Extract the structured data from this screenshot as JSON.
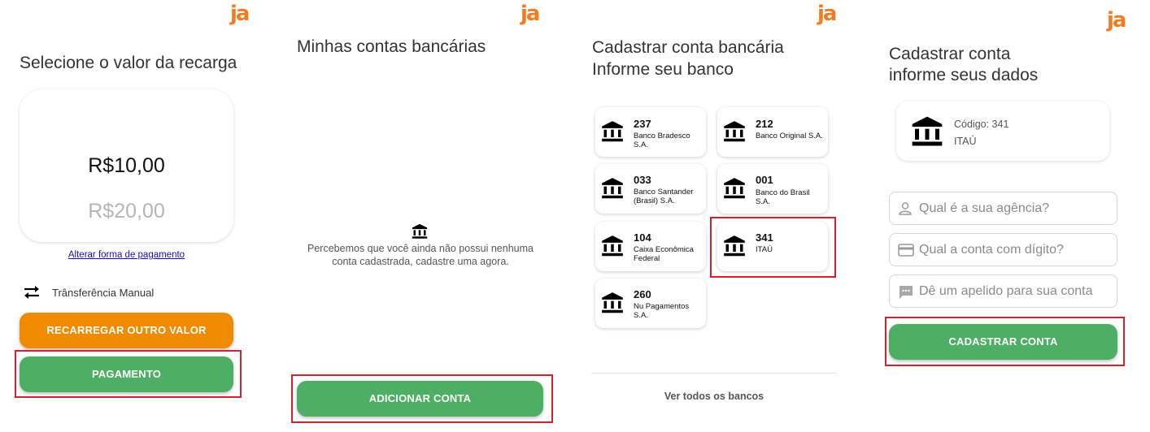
{
  "brand": {
    "logo_text": "ja",
    "accent": "#f07b21",
    "green": "#4caf63",
    "orange": "#f08a00",
    "highlight": "#d9202a"
  },
  "screen1": {
    "title": "Selecione o valor da recarga",
    "value_selected": "R$10,00",
    "value_next": "R$20,00",
    "change_payment_link": "Alterar forma de pagamento",
    "transfer_icon": "swap-arrows-icon",
    "transfer_label": "Trânsferência Manual",
    "recharge_other_button": "RECARREGAR OUTRO VALOR",
    "payment_button": "PAGAMENTO"
  },
  "screen2": {
    "title": "Minhas contas bancárias",
    "empty_icon": "bank-icon",
    "empty_message": "Percebemos que você ainda não possui nenhuma conta cadastrada, cadastre uma agora.",
    "add_account_button": "ADICIONAR CONTA"
  },
  "screen3": {
    "title_line1": "Cadastrar conta bancária",
    "title_line2": "Informe seu banco",
    "banks": [
      {
        "code": "237",
        "name": "Banco Bradesco S.A."
      },
      {
        "code": "212",
        "name": "Banco Original S.A."
      },
      {
        "code": "033",
        "name": "Banco Santander (Brasil) S.A."
      },
      {
        "code": "001",
        "name": "Banco do Brasil S.A."
      },
      {
        "code": "104",
        "name": "Caixa Econômica Federal"
      },
      {
        "code": "341",
        "name": "ITAÚ"
      },
      {
        "code": "260",
        "name": "Nu Pagamentos S.A."
      }
    ],
    "see_all_link": "Ver todos os bancos"
  },
  "screen4": {
    "title_line1": "Cadastrar conta",
    "title_line2": "informe seus dados",
    "selected_bank_code": "Código: 341",
    "selected_bank_name": "ITAÚ",
    "agency_placeholder": "Qual é a sua agência?",
    "account_placeholder": "Qual a conta com dígito?",
    "nickname_placeholder": "Dê um apelido para sua conta",
    "register_button": "CADASTRAR CONTA"
  }
}
